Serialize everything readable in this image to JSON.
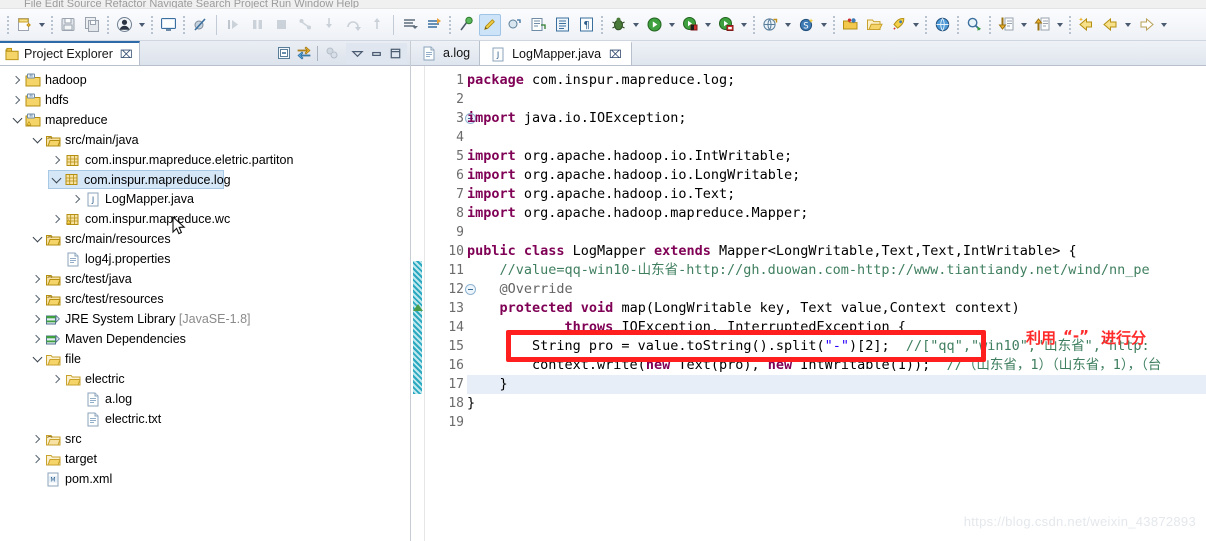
{
  "window": {
    "menu_sliver_text": "File   Edit   Source   Refactor   Navigate   Search   Project   Run   Window   Help"
  },
  "toolbar": {
    "groups": [
      {
        "name": "new-group",
        "buttons": [
          {
            "name": "new-wizard-button",
            "icon": "new-file-icon",
            "dropdown": true,
            "active": false
          }
        ]
      },
      {
        "name": "save-group",
        "buttons": [
          {
            "name": "save-button",
            "icon": "save-icon",
            "dropdown": false,
            "active": false
          },
          {
            "name": "save-all-button",
            "icon": "save-all-icon",
            "dropdown": false,
            "active": false
          }
        ]
      },
      {
        "name": "user-group",
        "buttons": [
          {
            "name": "user-button",
            "icon": "user-icon",
            "dropdown": true,
            "active": false
          }
        ]
      },
      {
        "name": "console-group",
        "buttons": [
          {
            "name": "open-console-button",
            "icon": "console-icon",
            "dropdown": false,
            "active": false
          }
        ]
      },
      {
        "name": "skip-breakpoints-group",
        "buttons": [
          {
            "name": "skip-all-breakpoints-button",
            "icon": "skip-breakpoints-icon",
            "dropdown": false,
            "active": false
          }
        ]
      },
      {
        "name": "debug-step-group",
        "buttons": [
          {
            "name": "resume-button",
            "icon": "resume-icon",
            "dropdown": false,
            "active": false
          },
          {
            "name": "suspend-button",
            "icon": "suspend-icon",
            "dropdown": false,
            "active": false
          },
          {
            "name": "terminate-button",
            "icon": "terminate-icon",
            "dropdown": false,
            "active": false
          },
          {
            "name": "disconnect-button",
            "icon": "disconnect-icon",
            "dropdown": false,
            "active": false
          },
          {
            "name": "step-into-button",
            "icon": "step-into-icon",
            "dropdown": false,
            "active": false
          },
          {
            "name": "step-over-button",
            "icon": "step-over-icon",
            "dropdown": false,
            "active": false
          },
          {
            "name": "step-return-button",
            "icon": "step-return-icon",
            "dropdown": false,
            "active": false
          }
        ]
      },
      {
        "name": "nav-group",
        "buttons": [
          {
            "name": "next-annotation-button",
            "icon": "next-annotation-icon",
            "dropdown": false,
            "active": false
          },
          {
            "name": "previous-annotation-button",
            "icon": "previous-annotation-icon",
            "dropdown": false,
            "active": false
          }
        ]
      },
      {
        "name": "marker-group",
        "buttons": [
          {
            "name": "toggle-mark-occurrences-button",
            "icon": "mark-occurrences-icon",
            "dropdown": false,
            "active": false
          },
          {
            "name": "pencil-button",
            "icon": "pencil-icon",
            "dropdown": false,
            "active": true
          },
          {
            "name": "new-java-class-button",
            "icon": "new-class-icon",
            "dropdown": false,
            "active": false
          },
          {
            "name": "new-java-package-button",
            "icon": "new-package-icon",
            "dropdown": false,
            "active": false
          },
          {
            "name": "open-task-button",
            "icon": "task-icon",
            "dropdown": false,
            "active": false
          },
          {
            "name": "open-type-button",
            "icon": "open-type-icon",
            "dropdown": false,
            "active": false
          }
        ]
      },
      {
        "name": "run-group",
        "buttons": [
          {
            "name": "debug-button",
            "icon": "bug-icon",
            "dropdown": true,
            "active": false
          },
          {
            "name": "run-button",
            "icon": "run-icon",
            "dropdown": true,
            "active": false
          },
          {
            "name": "run-server-button",
            "icon": "run-server-icon",
            "dropdown": true,
            "active": false
          },
          {
            "name": "run-coverage-button",
            "icon": "coverage-icon",
            "dropdown": true,
            "active": false
          }
        ]
      },
      {
        "name": "external-tools-group",
        "buttons": [
          {
            "name": "external-tools-button",
            "icon": "external-tools-icon",
            "dropdown": true,
            "active": false
          },
          {
            "name": "svn-button",
            "icon": "svn-icon",
            "dropdown": true,
            "active": false
          }
        ]
      },
      {
        "name": "open-group",
        "buttons": [
          {
            "name": "open-resource-button",
            "icon": "open-resource-icon",
            "dropdown": false,
            "active": false
          },
          {
            "name": "open-folder-button",
            "icon": "open-folder-icon",
            "dropdown": false,
            "active": false
          },
          {
            "name": "deploy-button",
            "icon": "rocket-icon",
            "dropdown": true,
            "active": false
          }
        ]
      },
      {
        "name": "web-group",
        "buttons": [
          {
            "name": "open-browser-button",
            "icon": "globe-icon",
            "dropdown": false,
            "active": false
          }
        ]
      },
      {
        "name": "search-group",
        "buttons": [
          {
            "name": "search-button",
            "icon": "search-icon",
            "dropdown": false,
            "active": false
          }
        ]
      },
      {
        "name": "updown-group",
        "buttons": [
          {
            "name": "download-button",
            "icon": "download-icon",
            "dropdown": true,
            "active": false
          },
          {
            "name": "upload-button",
            "icon": "upload-icon",
            "dropdown": true,
            "active": false
          }
        ]
      },
      {
        "name": "history-group",
        "buttons": [
          {
            "name": "back-history-button",
            "icon": "back-star-icon",
            "dropdown": false,
            "active": false
          },
          {
            "name": "back-button",
            "icon": "back-arrow-icon",
            "dropdown": true,
            "active": false
          },
          {
            "name": "forward-button",
            "icon": "forward-arrow-icon",
            "dropdown": true,
            "active": false
          }
        ]
      }
    ]
  },
  "project_explorer": {
    "tab_label": "Project Explorer",
    "tab_close_glyph": "⌧",
    "tools": [
      {
        "name": "collapse-all-button",
        "icon": "collapse-all-icon"
      },
      {
        "name": "link-with-editor-button",
        "icon": "link-editor-icon"
      },
      {
        "name": "view-menu-filters-button",
        "icon": "filters-icon"
      }
    ],
    "window_tools": [
      {
        "name": "view-menu-button",
        "icon": "chevron-down-icon"
      },
      {
        "name": "minimize-button",
        "icon": "minimize-icon"
      },
      {
        "name": "maximize-button",
        "icon": "maximize-icon"
      }
    ],
    "tree": [
      {
        "label": "hadoop",
        "indent": 0,
        "twist": "closed",
        "icon": "maven-project-icon",
        "selected": false
      },
      {
        "label": "hdfs",
        "indent": 0,
        "twist": "closed",
        "icon": "maven-project-icon",
        "selected": false
      },
      {
        "label": "mapreduce",
        "indent": 0,
        "twist": "open",
        "icon": "maven-project-warn-icon",
        "selected": false
      },
      {
        "label": "src/main/java",
        "indent": 1,
        "twist": "open",
        "icon": "source-folder-icon",
        "selected": false
      },
      {
        "label": "com.inspur.mapreduce.eletric.partiton",
        "indent": 2,
        "twist": "closed",
        "icon": "package-icon",
        "selected": false
      },
      {
        "label": "com.inspur.mapreduce.log",
        "indent": 2,
        "twist": "open",
        "icon": "package-icon",
        "selected": true
      },
      {
        "label": "LogMapper.java",
        "indent": 3,
        "twist": "closed",
        "icon": "java-file-icon",
        "selected": false
      },
      {
        "label": "com.inspur.mapreduce.wc",
        "indent": 2,
        "twist": "closed",
        "icon": "package-warn-icon",
        "selected": false
      },
      {
        "label": "src/main/resources",
        "indent": 1,
        "twist": "open",
        "icon": "source-folder-icon",
        "selected": false
      },
      {
        "label": "log4j.properties",
        "indent": 2,
        "twist": "none",
        "icon": "file-icon",
        "selected": false
      },
      {
        "label": "src/test/java",
        "indent": 1,
        "twist": "closed",
        "icon": "source-folder-icon",
        "selected": false
      },
      {
        "label": "src/test/resources",
        "indent": 1,
        "twist": "closed",
        "icon": "source-folder-icon",
        "selected": false
      },
      {
        "label": "JRE System Library",
        "suffix": " [JavaSE-1.8]",
        "indent": 1,
        "twist": "closed",
        "icon": "library-icon",
        "selected": false
      },
      {
        "label": "Maven Dependencies",
        "indent": 1,
        "twist": "closed",
        "icon": "library-icon",
        "selected": false
      },
      {
        "label": "file",
        "indent": 1,
        "twist": "open",
        "icon": "folder-icon",
        "selected": false
      },
      {
        "label": "electric",
        "indent": 2,
        "twist": "closed",
        "icon": "folder-icon",
        "selected": false
      },
      {
        "label": "a.log",
        "indent": 3,
        "twist": "none",
        "icon": "file-icon",
        "selected": false
      },
      {
        "label": "electric.txt",
        "indent": 3,
        "twist": "none",
        "icon": "file-icon",
        "selected": false
      },
      {
        "label": "src",
        "indent": 1,
        "twist": "closed",
        "icon": "source-folder-plain-icon",
        "selected": false
      },
      {
        "label": "target",
        "indent": 1,
        "twist": "closed",
        "icon": "folder-icon",
        "selected": false
      },
      {
        "label": "pom.xml",
        "indent": 1,
        "twist": "none",
        "icon": "maven-pom-icon",
        "selected": false
      }
    ]
  },
  "editor": {
    "tabs": [
      {
        "label": "a.log",
        "icon": "text-file-icon",
        "active": false,
        "closable": false
      },
      {
        "label": "LogMapper.java",
        "icon": "java-file-icon",
        "active": true,
        "closable": true,
        "close_glyph": "⌧"
      }
    ],
    "first_line": 1,
    "last_line": 19,
    "lines": [
      {
        "n": 1,
        "fold": false,
        "override": false,
        "changed": false,
        "highlight": false,
        "tokens": [
          {
            "t": "kw",
            "s": "package"
          },
          {
            "t": "pl",
            "s": " com.inspur.mapreduce.log;"
          }
        ]
      },
      {
        "n": 2,
        "fold": false,
        "override": false,
        "changed": false,
        "highlight": false,
        "tokens": []
      },
      {
        "n": 3,
        "fold": true,
        "override": false,
        "changed": false,
        "highlight": false,
        "tokens": [
          {
            "t": "kw",
            "s": "import"
          },
          {
            "t": "pl",
            "s": " java.io.IOException;"
          }
        ]
      },
      {
        "n": 4,
        "fold": false,
        "override": false,
        "changed": false,
        "highlight": false,
        "tokens": []
      },
      {
        "n": 5,
        "fold": false,
        "override": false,
        "changed": false,
        "highlight": false,
        "tokens": [
          {
            "t": "kw",
            "s": "import"
          },
          {
            "t": "pl",
            "s": " org.apache.hadoop.io.IntWritable;"
          }
        ]
      },
      {
        "n": 6,
        "fold": false,
        "override": false,
        "changed": false,
        "highlight": false,
        "tokens": [
          {
            "t": "kw",
            "s": "import"
          },
          {
            "t": "pl",
            "s": " org.apache.hadoop.io.LongWritable;"
          }
        ]
      },
      {
        "n": 7,
        "fold": false,
        "override": false,
        "changed": false,
        "highlight": false,
        "tokens": [
          {
            "t": "kw",
            "s": "import"
          },
          {
            "t": "pl",
            "s": " org.apache.hadoop.io.Text;"
          }
        ]
      },
      {
        "n": 8,
        "fold": false,
        "override": false,
        "changed": false,
        "highlight": false,
        "tokens": [
          {
            "t": "kw",
            "s": "import"
          },
          {
            "t": "pl",
            "s": " org.apache.hadoop.mapreduce.Mapper;"
          }
        ]
      },
      {
        "n": 9,
        "fold": false,
        "override": false,
        "changed": false,
        "highlight": false,
        "tokens": []
      },
      {
        "n": 10,
        "fold": false,
        "override": false,
        "changed": false,
        "highlight": false,
        "tokens": [
          {
            "t": "kw",
            "s": "public class"
          },
          {
            "t": "pl",
            "s": " LogMapper "
          },
          {
            "t": "kw",
            "s": "extends"
          },
          {
            "t": "pl",
            "s": " Mapper<LongWritable,Text,Text,IntWritable> {"
          }
        ]
      },
      {
        "n": 11,
        "fold": false,
        "override": false,
        "changed": true,
        "highlight": false,
        "tokens": [
          {
            "t": "cmt",
            "s": "    //value=qq-win10-山东省-http://gh.duowan.com-http://www.tiantiandy.net/wind/nn_pe"
          }
        ]
      },
      {
        "n": 12,
        "fold": true,
        "override": false,
        "changed": true,
        "highlight": false,
        "tokens": [
          {
            "t": "an",
            "s": "    @Override"
          }
        ]
      },
      {
        "n": 13,
        "fold": false,
        "override": true,
        "changed": true,
        "highlight": false,
        "tokens": [
          {
            "t": "kw",
            "s": "    protected void"
          },
          {
            "t": "pl",
            "s": " map(LongWritable key, Text value,Context context)"
          }
        ]
      },
      {
        "n": 14,
        "fold": false,
        "override": false,
        "changed": true,
        "highlight": false,
        "tokens": [
          {
            "t": "kw",
            "s": "            throws"
          },
          {
            "t": "pl",
            "s": " IOException, InterruptedException {"
          }
        ]
      },
      {
        "n": 15,
        "fold": false,
        "override": false,
        "changed": true,
        "highlight": false,
        "tokens": [
          {
            "t": "pl",
            "s": "        String pro = value.toString().split("
          },
          {
            "t": "str",
            "s": "\"-\""
          },
          {
            "t": "pl",
            "s": ")[2];  "
          },
          {
            "t": "cmt",
            "s": "//[\"qq\",\"win10\",\"山东省\",\"http:"
          }
        ]
      },
      {
        "n": 16,
        "fold": false,
        "override": false,
        "changed": true,
        "highlight": false,
        "tokens": [
          {
            "t": "pl",
            "s": "        context.write("
          },
          {
            "t": "kw",
            "s": "new"
          },
          {
            "t": "pl",
            "s": " Text(pro), "
          },
          {
            "t": "kw",
            "s": "new"
          },
          {
            "t": "pl",
            "s": " IntWritable(1));  "
          },
          {
            "t": "cmt",
            "s": "//（山东省，1）（山东省，1），（台"
          }
        ]
      },
      {
        "n": 17,
        "fold": false,
        "override": false,
        "changed": true,
        "highlight": true,
        "tokens": [
          {
            "t": "pl",
            "s": "    }"
          }
        ]
      },
      {
        "n": 18,
        "fold": false,
        "override": false,
        "changed": false,
        "highlight": false,
        "tokens": [
          {
            "t": "pl",
            "s": "}"
          }
        ]
      },
      {
        "n": 19,
        "fold": false,
        "override": false,
        "changed": false,
        "highlight": false,
        "tokens": []
      }
    ]
  },
  "annotations": {
    "red_box_label": "highlight-rectangle-line-15",
    "red_text_1": "利用",
    "red_text_2": "“-”",
    "red_text_3": "进行分",
    "color": "#ff1f1f"
  },
  "watermark": {
    "text": "https://blog.csdn.net/weixin_43872893"
  }
}
